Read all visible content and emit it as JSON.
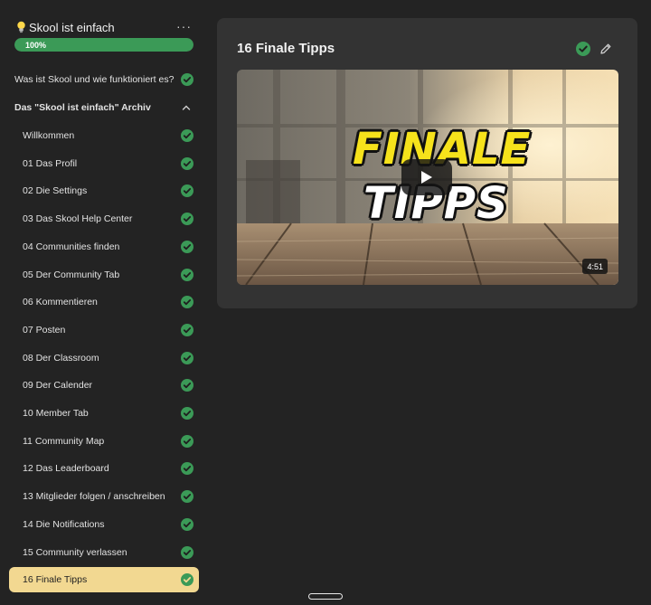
{
  "course": {
    "title": "Skool ist einfach",
    "icon": "lightbulb-icon",
    "progress_label": "100%",
    "progress_fraction": 1.0,
    "options_label": "···"
  },
  "menu": {
    "intro": {
      "label": "Was ist Skool und wie funktioniert es?",
      "completed": true
    },
    "section": {
      "label": "Das \"Skool ist einfach\" Archiv",
      "expanded": true
    },
    "lessons": [
      {
        "label": "Willkommen",
        "completed": true
      },
      {
        "label": "01 Das Profil",
        "completed": true
      },
      {
        "label": "02 Die Settings",
        "completed": true
      },
      {
        "label": "03 Das Skool Help Center",
        "completed": true
      },
      {
        "label": "04 Communities finden",
        "completed": true
      },
      {
        "label": "05 Der Community Tab",
        "completed": true
      },
      {
        "label": "06 Kommentieren",
        "completed": true
      },
      {
        "label": "07 Posten",
        "completed": true
      },
      {
        "label": "08 Der Classroom",
        "completed": true
      },
      {
        "label": "09 Der Calender",
        "completed": true
      },
      {
        "label": "10 Member Tab",
        "completed": true
      },
      {
        "label": "11 Community Map",
        "completed": true
      },
      {
        "label": "12 Das Leaderboard",
        "completed": true
      },
      {
        "label": "13 Mitglieder folgen / anschreiben",
        "completed": true
      },
      {
        "label": "14 Die Notifications",
        "completed": true
      },
      {
        "label": "15 Community verlassen",
        "completed": true
      },
      {
        "label": "16 Finale Tipps",
        "completed": true,
        "active": true
      }
    ]
  },
  "lesson": {
    "title": "16 Finale Tipps",
    "completed": true,
    "video": {
      "thumbnail_line1": "FINALE",
      "thumbnail_line2": "TIPPS",
      "duration": "4:51"
    }
  },
  "colors": {
    "background": "#232323",
    "card": "#333333",
    "accent_green": "#3b9a57",
    "active_item": "#f2d891",
    "thumbnail_yellow": "#f6e21b"
  }
}
